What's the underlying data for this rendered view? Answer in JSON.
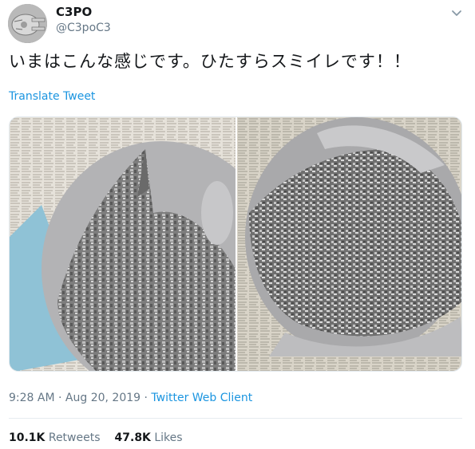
{
  "user": {
    "display_name": "C3PO",
    "handle": "@C3poC3"
  },
  "tweet": {
    "text": "いまはこんな感じです。ひたすらスミイレです！！",
    "translate_label": "Translate Tweet"
  },
  "media": {
    "photos": [
      {
        "icon": "photo-spaceship-model-in-progress-icon"
      },
      {
        "icon": "photo-spaceship-model-panel-icon"
      }
    ]
  },
  "meta": {
    "time": "9:28 AM",
    "separator1": " · ",
    "date": "Aug 20, 2019",
    "separator2": " · ",
    "client": "Twitter Web Client"
  },
  "stats": {
    "retweets_count": "10.1K",
    "retweets_label": "Retweets",
    "likes_count": "47.8K",
    "likes_label": "Likes"
  },
  "colors": {
    "link": "#1b95e0",
    "secondary_text": "#657786",
    "primary_text": "#14171a"
  }
}
